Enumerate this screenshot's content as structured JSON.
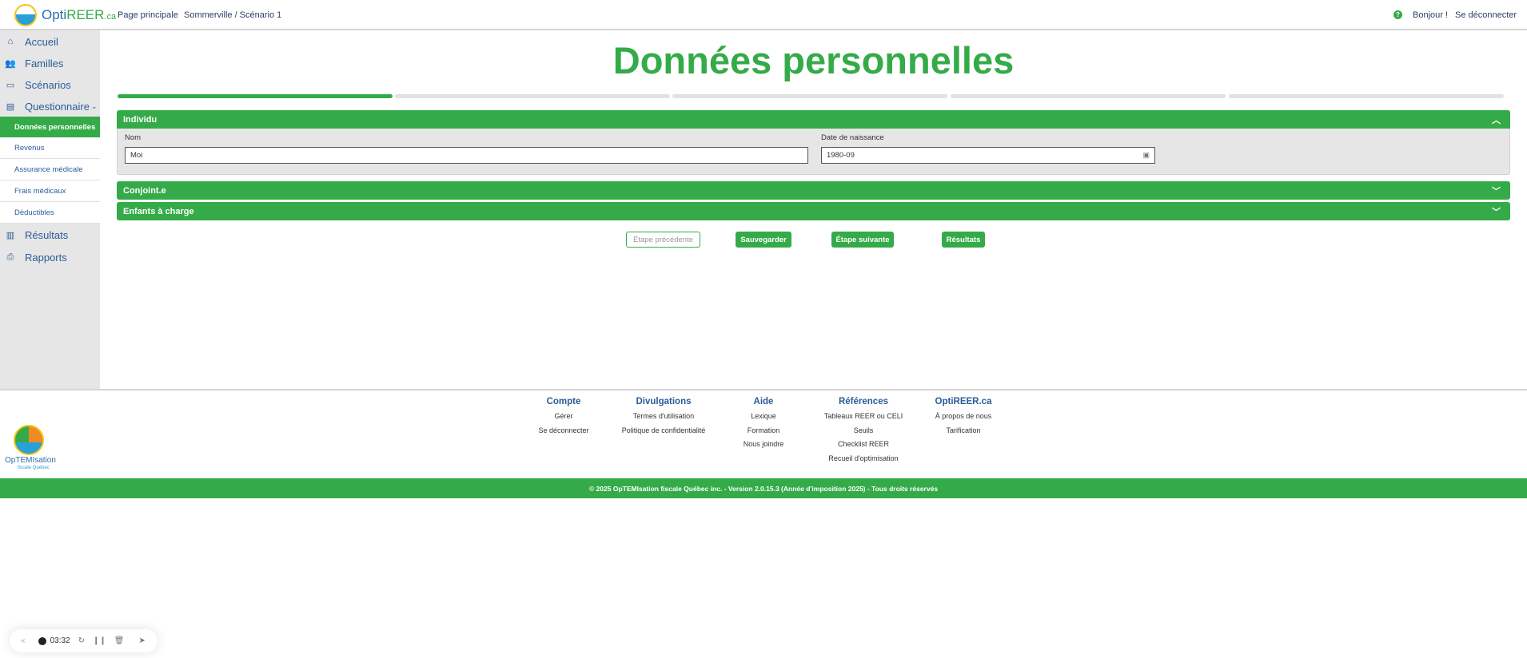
{
  "header": {
    "logo": {
      "text_main": "Opti",
      "text_accent": "REER",
      "text_suffix": ".ca"
    },
    "nav": [
      "Page principale",
      "Sommerville / Scénario 1"
    ],
    "help_icon": "question-circle-icon",
    "greeting": "Bonjour !",
    "logout": "Se déconnecter"
  },
  "sidebar": {
    "items": [
      {
        "label": "Accueil",
        "icon": "home-icon"
      },
      {
        "label": "Familles",
        "icon": "users-icon"
      },
      {
        "label": "Scénarios",
        "icon": "image-icon"
      },
      {
        "label": "Questionnaire",
        "icon": "document-icon"
      },
      {
        "label": "Résultats",
        "icon": "bar-chart-icon"
      },
      {
        "label": "Rapports",
        "icon": "report-icon"
      }
    ],
    "sub_items": [
      "Données personnelles",
      "Revenus",
      "Assurance médicale",
      "Frais médicaux",
      "Déductibles"
    ]
  },
  "main": {
    "title": "Données personnelles",
    "progress": {
      "current_step": 1,
      "total_steps": 5
    },
    "sections": [
      {
        "label": "Individu",
        "expanded": true
      },
      {
        "label": "Conjoint.e",
        "expanded": false
      },
      {
        "label": "Enfants à charge",
        "expanded": false
      }
    ],
    "fields": {
      "nom_label": "Nom",
      "nom_value": "Moi",
      "dob_label": "Date de naissance",
      "dob_value": "1980-09"
    },
    "buttons": {
      "prev": "Étape précédente",
      "save": "Sauvegarder",
      "next": "Étape suivante",
      "results": "Résultats"
    }
  },
  "footer": {
    "logo_text": "OpTEMIsation",
    "logo_sub": "fiscale Québec",
    "columns": [
      {
        "title": "Compte",
        "links": [
          "Gérer",
          "Se déconnecter"
        ]
      },
      {
        "title": "Divulgations",
        "links": [
          "Termes d'utilisation",
          "Politique de confidentialité"
        ]
      },
      {
        "title": "Aide",
        "links": [
          "Lexique",
          "Formation",
          "Nous joindre"
        ]
      },
      {
        "title": "Références",
        "links": [
          "Tableaux REER ou CELI",
          "Seuils",
          "Checklist REER",
          "Recueil d'optimisation"
        ]
      },
      {
        "title": "OptiREER.ca",
        "links": [
          "À propos de nous",
          "Tarification"
        ]
      }
    ],
    "copyright": "© 2025 OpTEMIsation fiscale Québec inc. - Version 2.0.15.3 (Année d'imposition 2025) - Tous droits réservés"
  },
  "recorder": {
    "time": "03:32"
  },
  "colors": {
    "accent": "#34ab48",
    "link": "#2a5c9a"
  }
}
